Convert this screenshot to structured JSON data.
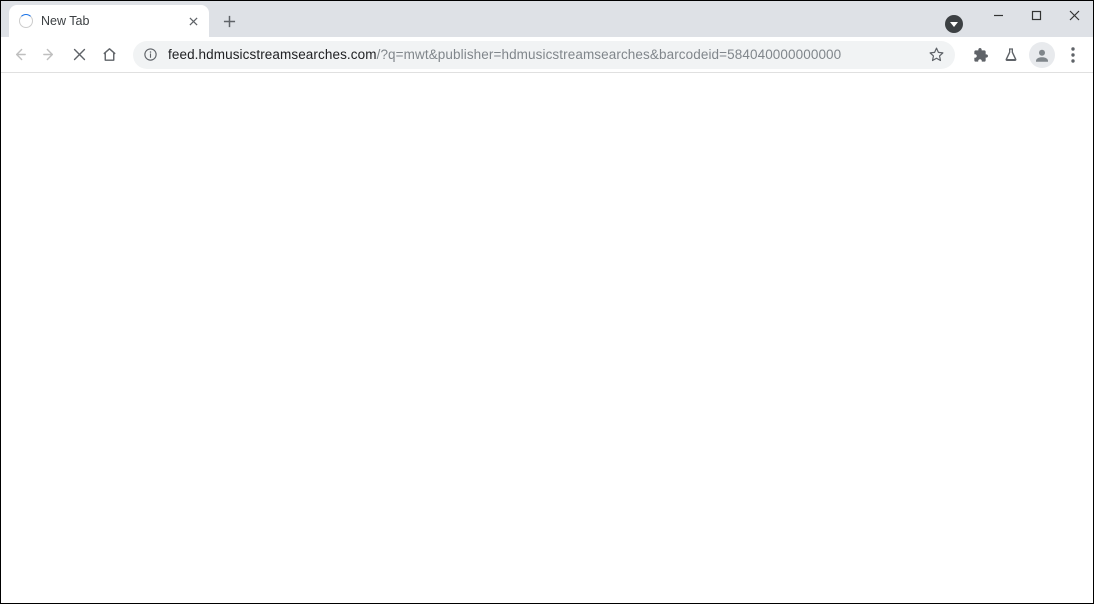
{
  "tab": {
    "title": "New Tab"
  },
  "url": {
    "host": "feed.hdmusicstreamsearches.com",
    "path": "/?q=mwt&publisher=hdmusicstreamsearches&barcodeid=584040000000000"
  }
}
